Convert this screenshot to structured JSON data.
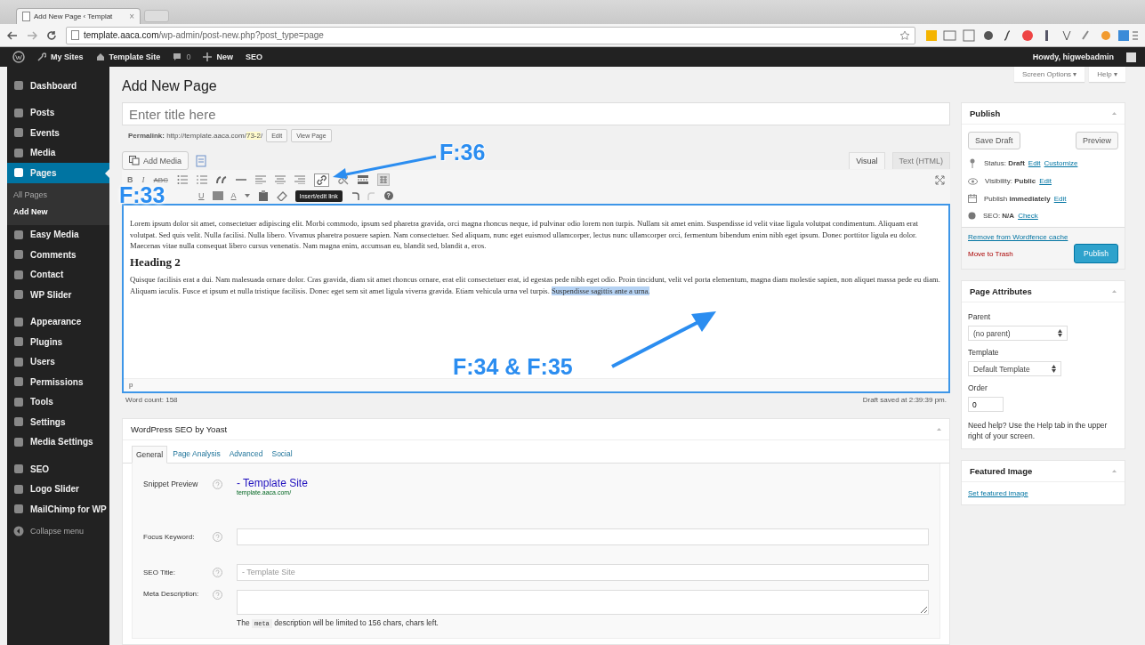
{
  "browser": {
    "tab_title": "Add New Page ‹ Templat",
    "tab_close": "×",
    "url_host": "template.aaca.com",
    "url_path": "/wp-admin/post-new.php?post_type=page"
  },
  "admin_bar": {
    "items": [
      "My Sites",
      "Template Site",
      "0",
      "New",
      "SEO"
    ],
    "greeting": "Howdy, higwebadmin"
  },
  "sidebar": {
    "groups": [
      {
        "items": [
          {
            "label": "Dashboard",
            "selected": false
          }
        ]
      },
      {
        "items": [
          {
            "label": "Posts",
            "selected": false
          },
          {
            "label": "Events",
            "selected": false
          },
          {
            "label": "Media",
            "selected": false
          },
          {
            "label": "Pages",
            "selected": true,
            "children": [
              {
                "label": "All Pages",
                "selected": false
              },
              {
                "label": "Add New",
                "selected": true
              }
            ]
          },
          {
            "label": "Easy Media",
            "selected": false
          },
          {
            "label": "Comments",
            "selected": false
          },
          {
            "label": "Contact",
            "selected": false
          },
          {
            "label": "WP Slider",
            "selected": false
          }
        ]
      },
      {
        "items": [
          {
            "label": "Appearance",
            "selected": false
          },
          {
            "label": "Plugins",
            "selected": false
          },
          {
            "label": "Users",
            "selected": false
          },
          {
            "label": "Permissions",
            "selected": false
          },
          {
            "label": "Tools",
            "selected": false
          },
          {
            "label": "Settings",
            "selected": false
          },
          {
            "label": "Media Settings",
            "selected": false
          }
        ]
      },
      {
        "items": [
          {
            "label": "SEO",
            "selected": false
          },
          {
            "label": "Logo Slider",
            "selected": false
          },
          {
            "label": "MailChimp for WP",
            "selected": false
          }
        ]
      }
    ],
    "collapse": "Collapse menu"
  },
  "screen_meta": [
    "Screen Options ▾",
    "Help ▾"
  ],
  "page_title": "Add New Page",
  "title_field": {
    "placeholder": "Enter title here"
  },
  "permalink": {
    "label": "Permalink:",
    "base": "http://template.aaca.com/",
    "slug": "73-2",
    "end": "/",
    "buttons": [
      "Edit",
      "View Page"
    ]
  },
  "add_media": "Add Media",
  "editor": {
    "tabs": [
      {
        "label": "Visual",
        "selected": true
      },
      {
        "label": "Text (HTML)",
        "selected": false
      }
    ],
    "toolbar": {
      "bold": "B",
      "italic": "I",
      "strike": "ABC",
      "underline": "U",
      "font_color": "A",
      "help": "?"
    },
    "tooltip": "Insert/edit link",
    "paragraph_1": "Lorem ipsum dolor sit amet, consectetuer adipiscing elit. Morbi commodo, ipsum sed pharetra gravida, orci magna rhoncus neque, id pulvinar odio lorem non turpis. Nullam sit amet enim. Suspendisse id velit vitae ligula volutpat condimentum. Aliquam erat volutpat. Sed quis velit. Nulla facilisi. Nulla libero. Vivamus pharetra posuere sapien. Nam consectetuer. Sed aliquam, nunc eget euismod ullamcorper, lectus nunc ullamcorper orci, fermentum bibendum enim nibh eget ipsum. Donec porttitor ligula eu dolor. Maecenas vitae nulla consequat libero cursus venenatis. Nam magna enim, accumsan eu, blandit sed, blandit a, eros.",
    "heading": "Heading 2",
    "paragraph_2": "Quisque facilisis erat a dui. Nam malesuada ornare dolor. Cras gravida, diam sit amet rhoncus ornare, erat elit consectetuer erat, id egestas pede nibh eget odio. Proin tincidunt, velit vel porta elementum, magna diam molestie sapien, non aliquet massa pede eu diam. Aliquam iaculis. Fusce et ipsum et nulla tristique facilisis. Donec eget sem sit amet ligula viverra gravida. Etiam vehicula urna vel turpis.",
    "selected_text": "Suspendisse sagittis ante a urna.",
    "path": "p",
    "word_count": "Word count: 158",
    "draft_saved": "Draft saved at 2:39:39 pm."
  },
  "seo": {
    "title": "WordPress SEO by Yoast",
    "tabs": [
      {
        "label": "General",
        "selected": true
      },
      {
        "label": "Page Analysis",
        "selected": false
      },
      {
        "label": "Advanced",
        "selected": false
      },
      {
        "label": "Social",
        "selected": false
      }
    ],
    "snippet_label": "Snippet Preview",
    "snippet_title": "- Template Site",
    "snippet_url": "template.aaca.com/",
    "focus_label": "Focus Keyword:",
    "title_label": "SEO Title:",
    "title_placeholder": "- Template Site",
    "meta_label": "Meta Description:",
    "note_before": "The",
    "note_code": "meta",
    "note_after": "description will be limited to 156 chars, chars left."
  },
  "publish": {
    "title": "Publish",
    "save_draft": "Save Draft",
    "preview": "Preview",
    "status_label": "Status:",
    "status_value": "Draft",
    "visibility_label": "Visibility:",
    "visibility_value": "Public",
    "schedule_label": "Publish",
    "schedule_value": "immediately",
    "seo_label": "SEO:",
    "seo_value": "N/A",
    "status_edit_link": "Edit",
    "visibility_edit_link": "Edit",
    "schedule_edit_link": "Edit",
    "customize_link": "Customize",
    "check_link": "Check",
    "wordfence_link": "Remove from Wordfence cache",
    "trash_link": "Move to Trash",
    "publish_button": "Publish"
  },
  "attributes": {
    "title": "Page Attributes",
    "parent_label": "Parent",
    "parent_value": "(no parent)",
    "template_label": "Template",
    "template_value": "Default Template",
    "order_label": "Order",
    "order_value": "0",
    "help": "Need help? Use the Help tab in the upper right of your screen."
  },
  "featured": {
    "title": "Featured Image",
    "link": "Set featured image"
  },
  "annotations": [
    "F:36",
    "F:33",
    "F:34 & F:35"
  ]
}
